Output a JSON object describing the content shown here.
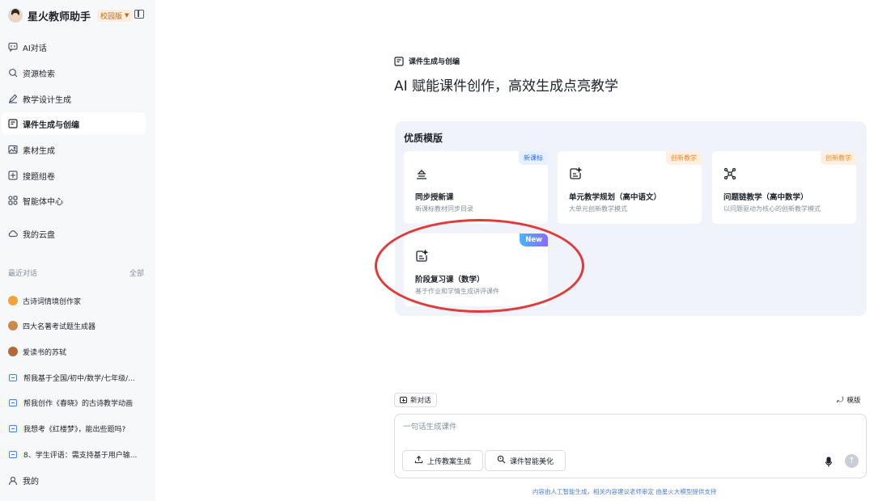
{
  "sidebar": {
    "brand": "星火教师助手",
    "edition": "校园版",
    "nav": [
      {
        "label": "AI对话",
        "icon": "chat-icon"
      },
      {
        "label": "资源检索",
        "icon": "search-icon"
      },
      {
        "label": "教学设计生成",
        "icon": "pen-icon"
      },
      {
        "label": "课件生成与创编",
        "icon": "courseware-icon"
      },
      {
        "label": "素材生成",
        "icon": "image-icon"
      },
      {
        "label": "搜题组卷",
        "icon": "exam-icon"
      },
      {
        "label": "智能体中心",
        "icon": "agents-icon"
      },
      {
        "label": "我的云盘",
        "icon": "cloud-icon"
      }
    ],
    "recent_title": "最近对话",
    "recent_all": "全部",
    "recent": [
      {
        "label": "古诗词情境创作家",
        "type": "bot",
        "color": "#f0a23c"
      },
      {
        "label": "四大名著考试题生成器",
        "type": "bot",
        "color": "#c98a4b"
      },
      {
        "label": "爱读书的苏轼",
        "type": "bot",
        "color": "#b5673a"
      },
      {
        "label": "帮我基于全国/初中/数学/七年级/...",
        "type": "chat"
      },
      {
        "label": "帮我创作《春晓》的古诗教学动画",
        "type": "chat"
      },
      {
        "label": "我想考《红楼梦》，能出些题吗?",
        "type": "chat"
      },
      {
        "label": "8、学生评语：需支持基于用户输...",
        "type": "chat"
      }
    ],
    "user_label": "我的"
  },
  "main": {
    "page_tag": "课件生成与创编",
    "headline": "AI 赋能课件创作，高效生成点亮教学",
    "panel_title": "优质模版",
    "cards": [
      {
        "title": "同步授新课",
        "desc": "新课标教材同步目录",
        "badge": "新课标",
        "badge_style": "blue",
        "icon": "lectern-icon"
      },
      {
        "title": "单元教学规划（高中语文）",
        "desc": "大单元创新教学模式",
        "badge": "创新教学",
        "badge_style": "orange",
        "icon": "doc-sparkle-icon"
      },
      {
        "title": "问题链教学（高中数学）",
        "desc": "以问题驱动为核心的创新教学模式",
        "badge": "创新教学",
        "badge_style": "orange",
        "icon": "molecule-icon"
      },
      {
        "title": "阶段复习课（数学）",
        "desc": "基于作业和学情生成讲评课件",
        "badge": "New",
        "badge_style": "new",
        "icon": "doc-sparkle-icon"
      }
    ]
  },
  "composer": {
    "new_chat": "新对话",
    "template_link": "模版",
    "placeholder": "一句话生成课件",
    "upload_label": "上传教案生成",
    "beautify_label": "课件智能美化"
  },
  "footer": "内容由人工智能生成，相关内容建议老师审定 由星火大模型提供支持"
}
